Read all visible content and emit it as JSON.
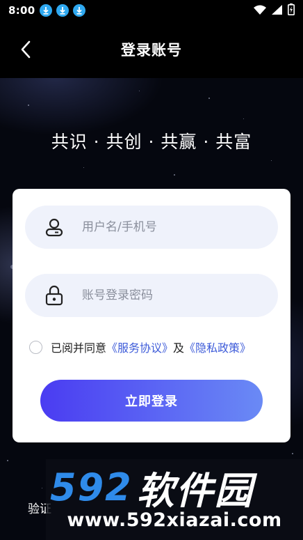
{
  "status_bar": {
    "time": "8:00",
    "notification_icons": [
      "download-icon",
      "download-icon",
      "download-icon"
    ],
    "right_icons": [
      "wifi-icon",
      "signal-icon",
      "battery-charging-icon"
    ]
  },
  "header": {
    "back_icon": "chevron-left-icon",
    "title": "登录账号"
  },
  "slogan": "共识 · 共创 · 共赢 · 共富",
  "form": {
    "username": {
      "icon": "user-icon",
      "placeholder": "用户名/手机号",
      "value": ""
    },
    "password": {
      "icon": "lock-icon",
      "placeholder": "账号登录密码",
      "value": ""
    },
    "agreement": {
      "checked": false,
      "prefix": "已阅并同意",
      "service_link": "《服务协议》",
      "conjunction": "及",
      "privacy_link": "《隐私政策》"
    },
    "login_button": "立即登录"
  },
  "bottom": {
    "partial_text": "验证"
  },
  "watermark": {
    "number": "592",
    "chinese": "软件园",
    "url": "www.592xiazai.com"
  },
  "colors": {
    "background": "#05070f",
    "card": "#ffffff",
    "input_bg": "#eff2fb",
    "link": "#3d5bd9",
    "button_gradient_start": "#4a3cf2",
    "button_gradient_end": "#6a8af5",
    "watermark_number": "#2f8bea",
    "download_badge": "#2ea8f0"
  }
}
